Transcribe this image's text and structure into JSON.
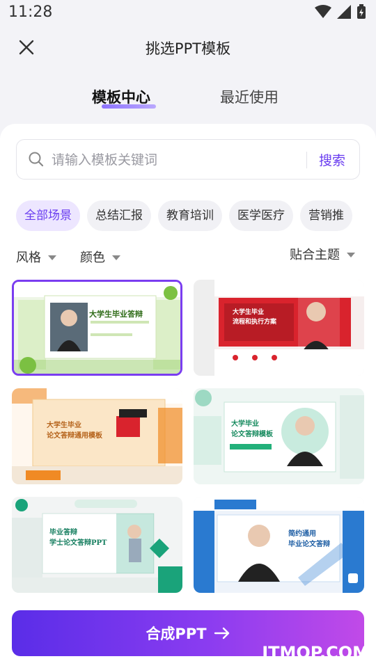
{
  "status_bar": {
    "time": "11:28"
  },
  "header": {
    "title": "挑选PPT模板"
  },
  "tabs": [
    {
      "label": "模板中心",
      "active": true
    },
    {
      "label": "最近使用",
      "active": false
    }
  ],
  "search": {
    "placeholder": "请输入模板关键词",
    "button_label": "搜索"
  },
  "categories": [
    "全部场景",
    "总结汇报",
    "教育培训",
    "医学医疗",
    "营销推"
  ],
  "filters": {
    "style_label": "风格",
    "color_label": "颜色",
    "sort_label": "贴合主题"
  },
  "templates": [
    {
      "title": "大学生毕业答辩",
      "theme_color": "#7cc142",
      "selected": true
    },
    {
      "title": "大学生毕业\n流程和执行方案",
      "theme_color": "#d9232d",
      "selected": false
    },
    {
      "title": "大学生毕业\n论文答辩通用模板",
      "theme_color": "#f08a24",
      "selected": false
    },
    {
      "title": "大学毕业\n论文答辩模板",
      "theme_color": "#22b07a",
      "selected": false
    },
    {
      "title": "毕业答辩\n学士论文答辩PPT",
      "theme_color": "#1aa37a",
      "selected": false
    },
    {
      "title": "简约通用\n毕业论文答辩",
      "theme_color": "#2a7ad0",
      "selected": false
    }
  ],
  "cta": {
    "label": "合成PPT"
  },
  "watermark": {
    "text": "ITMOP.COM"
  },
  "colors": {
    "accent": "#6a3df0",
    "chip_active_bg": "#ede6ff"
  }
}
